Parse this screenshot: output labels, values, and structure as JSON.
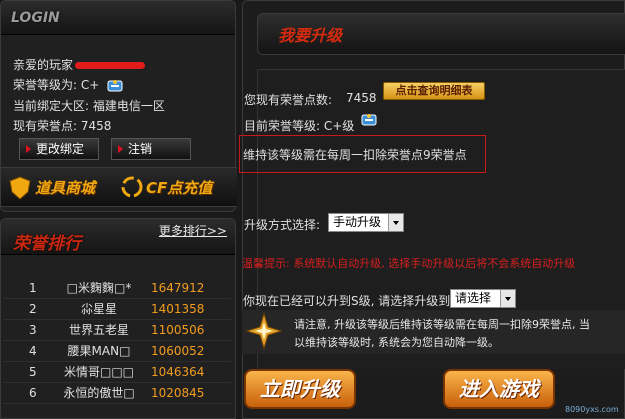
{
  "login": {
    "title": "LOGIN",
    "greeting": "亲爱的玩家",
    "honor_level": "荣誉等级为: C+",
    "server": "当前绑定大区: 福建电信一区",
    "points": "现有荣誉点: 7458",
    "change_binding": "更改绑定",
    "logout": "注销"
  },
  "shop": {
    "item_mall": "道具商城",
    "recharge": "CF点充值"
  },
  "ranking": {
    "title": "荣誉排行",
    "more": "更多排行>>",
    "rows": [
      {
        "rank": "1",
        "name": "□米麴麴□*",
        "points": "1647912"
      },
      {
        "rank": "2",
        "name": "尛星星",
        "points": "1401358"
      },
      {
        "rank": "3",
        "name": "世界五老星",
        "points": "1100506"
      },
      {
        "rank": "4",
        "name": "腰果MAN□",
        "points": "1060052"
      },
      {
        "rank": "5",
        "name": "米情哥□□□",
        "points": "1046364"
      },
      {
        "rank": "6",
        "name": "永恒的傲世□",
        "points": "1020845"
      }
    ]
  },
  "upgrade": {
    "title": "我要升级",
    "current_points_label": "您现有荣誉点数:",
    "current_points": "7458",
    "detail_button": "点击查询明细表",
    "current_level": "目前荣誉等级: C+级",
    "weekly_notice": "维持该等级需在每周一扣除荣誉点9荣誉点",
    "mode_label": "升级方式选择:",
    "mode_value": "手动升级",
    "warning": "温馨提示: 系统默认自动升级, 选择手动升级以后将不会系统自动升级",
    "target_label": "你现在已经可以升到S级, 请选择升级到",
    "target_value": "请选择",
    "note_line1": "请注意, 升级该等级后维持该等级需在每周一扣除9荣誉点, 当",
    "note_line2": "以维持该等级时, 系统会为您自动降一级。",
    "upgrade_now": "立即升级",
    "enter_game": "进入游戏"
  },
  "watermark": "8090yxs.com"
}
